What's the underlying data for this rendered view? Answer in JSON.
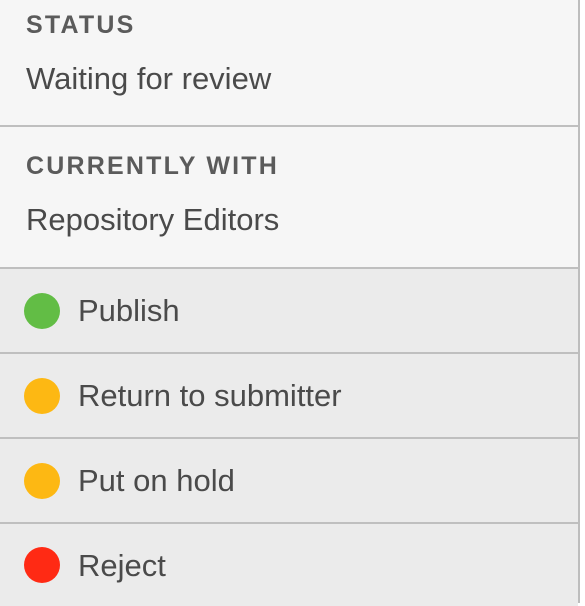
{
  "status": {
    "heading": "STATUS",
    "value": "Waiting for review"
  },
  "currently_with": {
    "heading": "CURRENTLY WITH",
    "value": "Repository Editors"
  },
  "actions": [
    {
      "label": "Publish",
      "icon": "green-circle-icon",
      "color": "#62bd45"
    },
    {
      "label": "Return to submitter",
      "icon": "amber-circle-icon",
      "color": "#fdb813"
    },
    {
      "label": "Put on hold",
      "icon": "amber-circle-icon",
      "color": "#fdb813"
    },
    {
      "label": "Reject",
      "icon": "red-circle-icon",
      "color": "#ff2a14"
    }
  ]
}
